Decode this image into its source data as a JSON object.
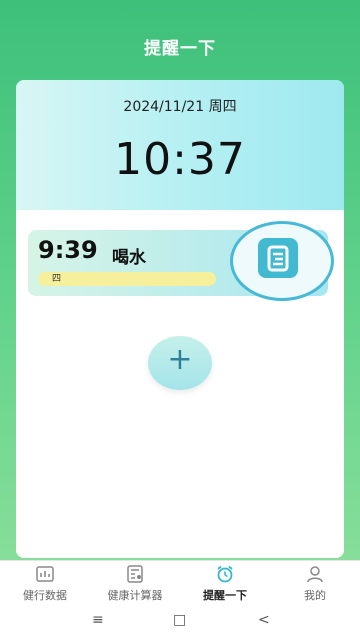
{
  "header": {
    "title": "提醒一下"
  },
  "today": {
    "date": "2024/11/21  周四",
    "time": "10:37"
  },
  "reminder": {
    "time": "9:39",
    "name": "喝水",
    "days": "四"
  },
  "add_button": {
    "label": "+"
  },
  "tabs": [
    {
      "label": "健行数据",
      "icon": "bar-chart-icon"
    },
    {
      "label": "健康计算器",
      "icon": "calculator-icon"
    },
    {
      "label": "提醒一下",
      "icon": "alarm-clock-icon",
      "active": true
    },
    {
      "label": "我的",
      "icon": "person-icon"
    }
  ],
  "system_nav": {
    "menu": "≡",
    "home": "□",
    "back": "<"
  },
  "colors": {
    "accent": "#41b9d0",
    "header_green": "#3dc07b",
    "active_tab": "#32b6cf"
  }
}
